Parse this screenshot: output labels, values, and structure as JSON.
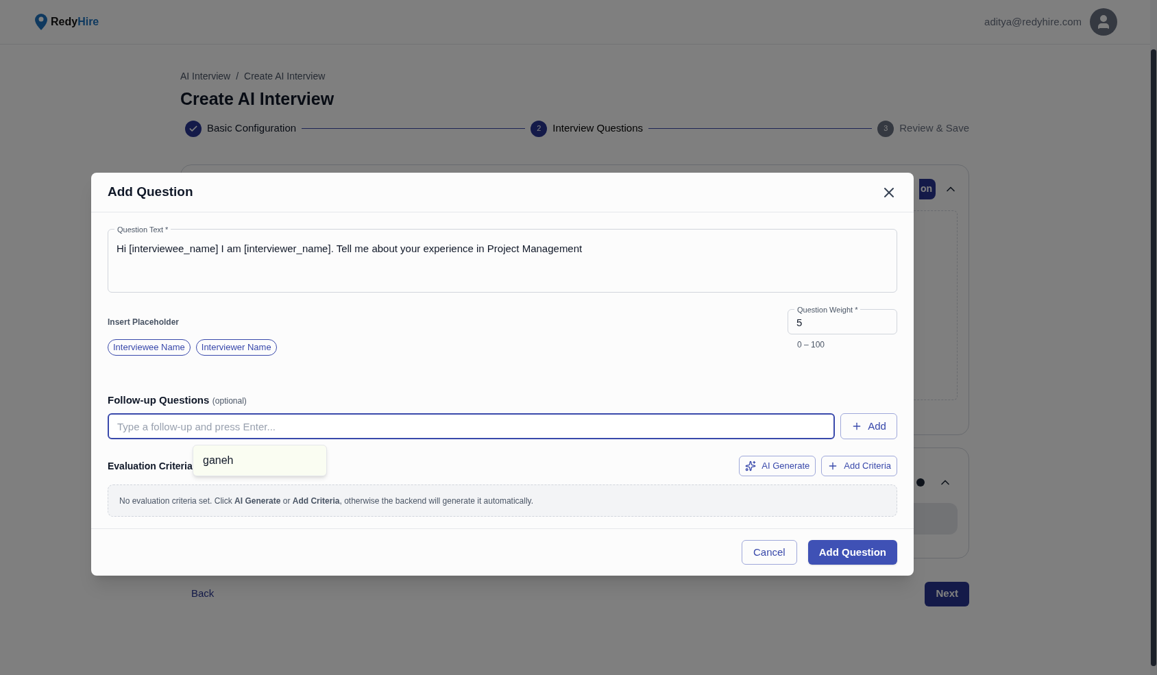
{
  "header": {
    "logo": {
      "part1": "Redy",
      "part2": "Hire"
    },
    "user_email": "aditya@redyhire.com"
  },
  "breadcrumb": {
    "items": [
      "AI Interview",
      "Create AI Interview"
    ],
    "separator": "/"
  },
  "page_title": "Create AI Interview",
  "steps": [
    {
      "label": "Basic Configuration",
      "completed": true,
      "selected": false
    },
    {
      "number": "2",
      "label": "Interview Questions",
      "completed": false,
      "selected": true
    },
    {
      "number": "3",
      "label": "Review & Save",
      "completed": false,
      "selected": false
    }
  ],
  "background_card": {
    "button_fragment": "on"
  },
  "footer": {
    "back": "Back",
    "next": "Next"
  },
  "dialog": {
    "title": "Add Question",
    "question_text": {
      "label": "Question Text *",
      "value": "Hi [interviewee_name] I am [interviewer_name]. Tell me about your experience in Project Management"
    },
    "insert_placeholder": {
      "label": "Insert Placeholder",
      "chips": [
        "Interviewee Name",
        "Interviewer Name"
      ]
    },
    "weight": {
      "label": "Question Weight *",
      "value": "5",
      "hint": "0 – 100"
    },
    "follow_up": {
      "label": "Follow-up Questions",
      "optional": "(optional)",
      "placeholder": "Type a follow-up and press Enter...",
      "focused": true,
      "add": "Add"
    },
    "autocomplete": [
      "ganeh"
    ],
    "evaluation": {
      "label": "Evaluation Criteria",
      "ai_generate": "AI Generate",
      "add_criteria": "Add Criteria",
      "empty_message": "No evaluation criteria set. Click **AI Generate** or **Add Criteria**, otherwise the backend will generate it automatically."
    },
    "cancel": "Cancel",
    "submit": "Add Question"
  }
}
